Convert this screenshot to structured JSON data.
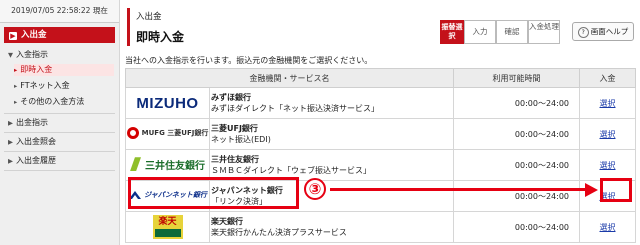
{
  "sidebar": {
    "datetime": "2019/07/05 22:58:22 現在",
    "main": "入出金",
    "items": [
      {
        "label": "入金指示"
      },
      {
        "label": "即時入金"
      },
      {
        "label": "FTネット入金"
      },
      {
        "label": "その他の入金方法"
      },
      {
        "label": "出金指示"
      },
      {
        "label": "入出金照会"
      },
      {
        "label": "入出金履歴"
      }
    ]
  },
  "header": {
    "breadcrumb": "入出金",
    "title": "即時入金",
    "steps": [
      "振替選択",
      "入力",
      "確認",
      "入金処理"
    ],
    "help": "画面ヘルプ"
  },
  "instruction": "当社への入金指示を行います。振込元の金融機関をご選択ください。",
  "table": {
    "headers": [
      "金融機関・サービス名",
      "利用可能時間",
      "入金"
    ],
    "rows": [
      {
        "logo": "MIZUHO",
        "bank": "みずほ銀行",
        "service": "みずほダイレクト「ネット振込決済サービス」",
        "time": "00:00～24:00",
        "action": "選択"
      },
      {
        "logo": "MUFG 三菱UFJ銀行",
        "bank": "三菱UFJ銀行",
        "service": "ネット振込(EDI)",
        "time": "00:00～24:00",
        "action": "選択"
      },
      {
        "logo": "三井住友銀行",
        "bank": "三井住友銀行",
        "service": "ＳＭＢＣダイレクト「ウェブ振込サービス」",
        "time": "00:00～24:00",
        "action": "選択"
      },
      {
        "logo": "ジャパンネット銀行",
        "bank": "ジャパンネット銀行",
        "service": "「リンク決済」",
        "time": "00:00～24:00",
        "action": "選択"
      },
      {
        "logo": "楽天",
        "bank": "楽天銀行",
        "service": "楽天銀行かんたん決済プラスサービス",
        "time": "00:00～24:00",
        "action": "選択"
      }
    ]
  },
  "annotation": {
    "step": "③",
    "color": "#e60012"
  },
  "colors": {
    "accent": "#c4111a",
    "link": "#1a3aa8"
  }
}
